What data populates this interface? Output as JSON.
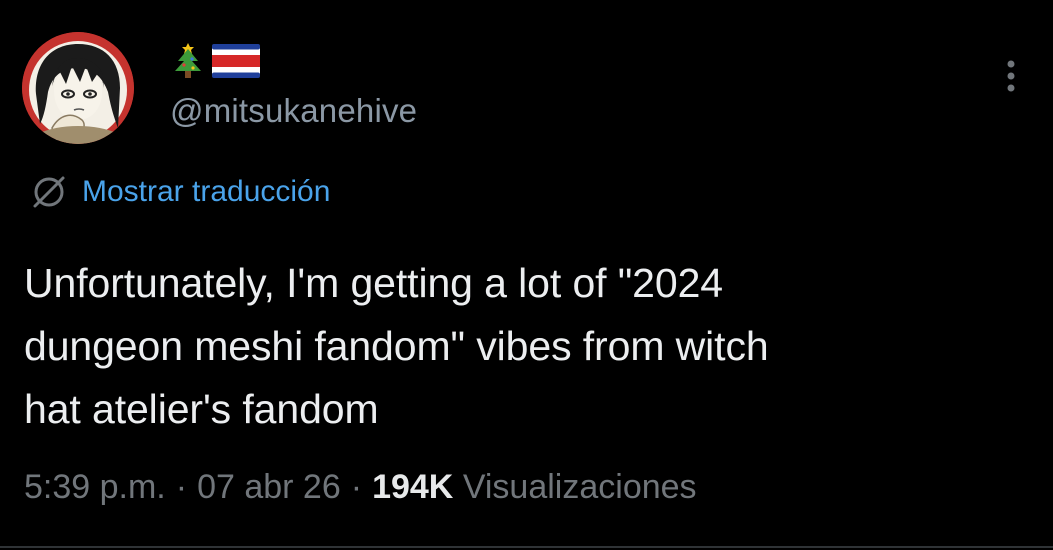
{
  "tweet": {
    "avatar_icon": "anime-avatar",
    "flags": [
      "christmas-tree-emoji",
      "costa-rica-flag-emoji"
    ],
    "handle": "@mitsukanehive",
    "more_icon": "vertical-ellipsis-icon",
    "translate": {
      "icon": "globe-slash-icon",
      "label": "Mostrar traducción"
    },
    "text_lines": [
      "Unfortunately, I'm getting a lot of \"2024",
      "dungeon meshi fandom\" vibes from witch",
      "hat atelier's fandom"
    ],
    "time": "5:39 p.m.",
    "separator": "·",
    "date": "07 abr 26",
    "views_count": "194K",
    "views_label": "Visualizaciones"
  },
  "colors": {
    "background": "#000000",
    "text": "#e7e9ea",
    "secondary": "#71767b",
    "link": "#4aa3ea",
    "avatar_ring": "#c5332e"
  }
}
